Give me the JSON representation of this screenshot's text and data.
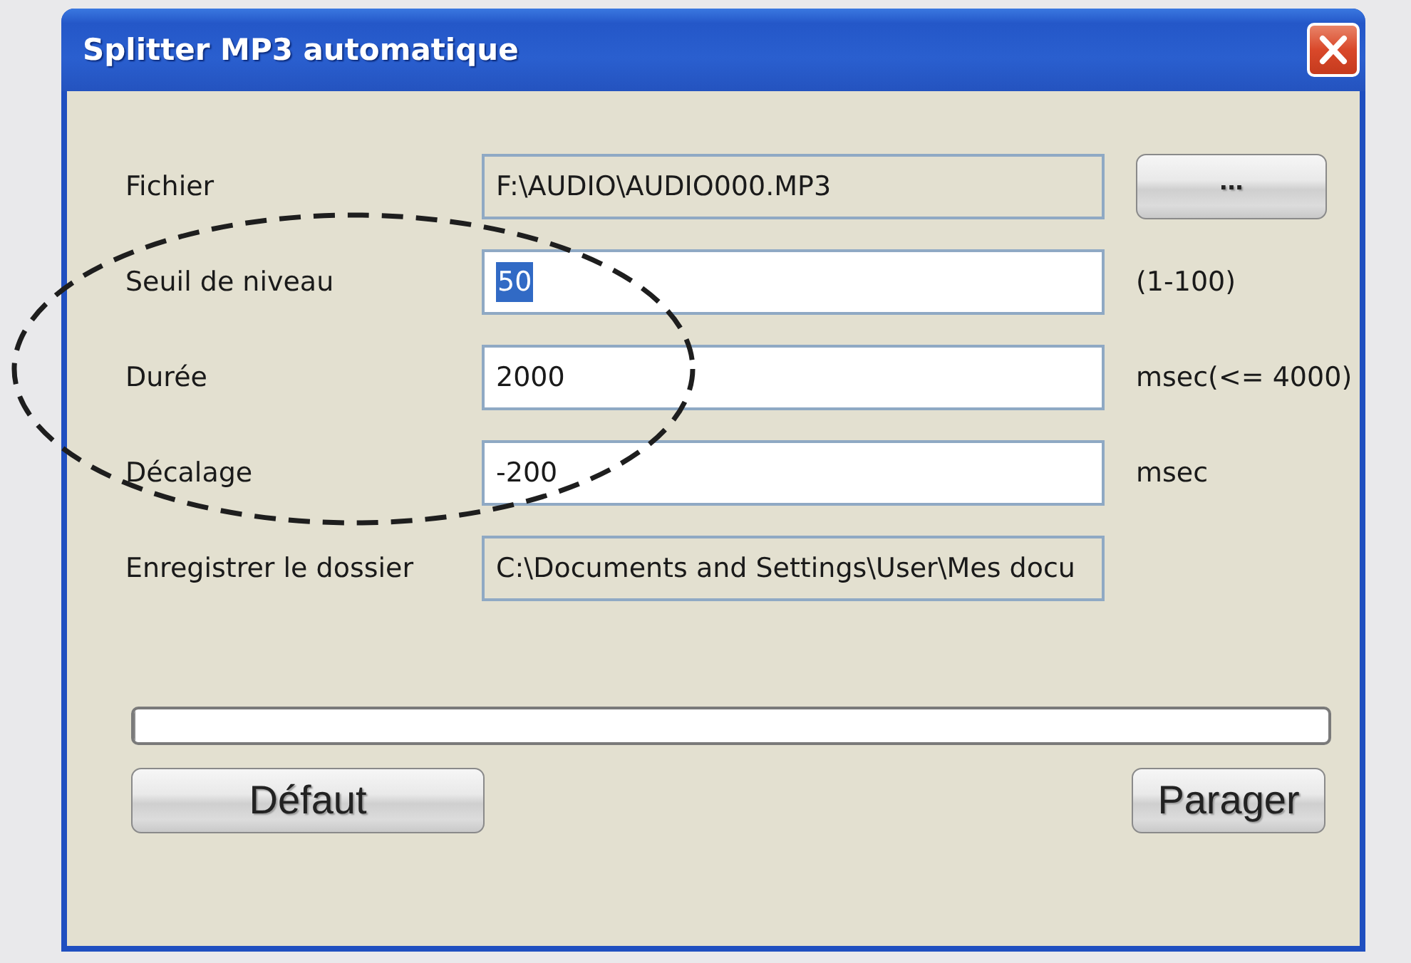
{
  "window": {
    "title": "Splitter MP3 automatique"
  },
  "fields": [
    {
      "label": "Fichier",
      "value": "F:\\AUDIO\\AUDIO000.MP3",
      "readonly": true,
      "value_selected": false,
      "suffix": {
        "kind": "button",
        "text": "..."
      }
    },
    {
      "label": "Seuil de niveau",
      "value": "50",
      "readonly": false,
      "value_selected": true,
      "suffix": {
        "kind": "text",
        "text": "(1-100)"
      }
    },
    {
      "label": "Durée",
      "value": "2000",
      "readonly": false,
      "value_selected": false,
      "suffix": {
        "kind": "text",
        "text": "msec(<= 4000)"
      }
    },
    {
      "label": "Décalage",
      "value": "-200",
      "readonly": false,
      "value_selected": false,
      "suffix": {
        "kind": "text",
        "text": "msec"
      }
    },
    {
      "label": "Enregistrer le dossier",
      "value": "C:\\Documents and Settings\\User\\Mes docu",
      "readonly": true,
      "value_selected": false
    }
  ],
  "progress": {
    "level": 0
  },
  "buttons": [
    {
      "label": "Défaut",
      "kind": "default"
    },
    {
      "label": "Parager",
      "kind": "split"
    }
  ],
  "annotation": {
    "kind": "dashed-ellipse"
  }
}
